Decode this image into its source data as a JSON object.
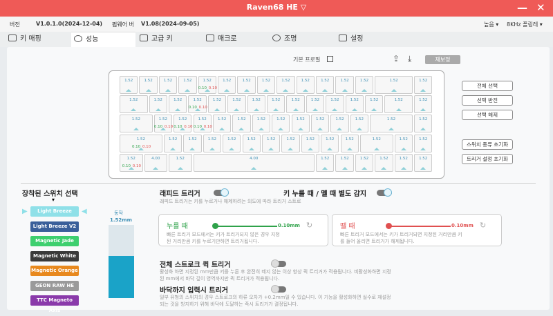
{
  "titlebar": {
    "title": "Raven68 HE ▽",
    "minimize": "—",
    "close": "✕"
  },
  "version": {
    "ver_label": "버전",
    "ver_value": "V1.0.1.0(2024-12-04)",
    "fw_label": "펌웨어 버",
    "fw_value": "V1.08(2024-09-05)",
    "right1": "높음 ▾",
    "right2": "8KHz 폴링레 ▾"
  },
  "tabs": [
    "키 매핑",
    "성능",
    "고급 키",
    "매크로",
    "조명",
    "설정"
  ],
  "profile": {
    "label": "기본 프로필",
    "button": "재보정"
  },
  "keyboard": {
    "rows": [
      [
        [
          "1.52"
        ],
        [
          "1.52"
        ],
        [
          "1.52"
        ],
        [
          "1.52"
        ],
        [
          "1.52",
          "0.10",
          "0.10"
        ],
        [
          "1.52"
        ],
        [
          "1.52"
        ],
        [
          "1.52"
        ],
        [
          "1.52"
        ],
        [
          "1.52"
        ],
        [
          "1.52"
        ],
        [
          "1.52"
        ],
        [
          "1.52"
        ],
        [
          "1.52"
        ],
        [
          "1.52"
        ]
      ],
      [
        [
          "1.52"
        ],
        [
          "1.52"
        ],
        [
          "1.52"
        ],
        [
          "1.52",
          "0.10",
          "0.10"
        ],
        [
          "1.52"
        ],
        [
          "1.52"
        ],
        [
          "1.52"
        ],
        [
          "1.52"
        ],
        [
          "1.52"
        ],
        [
          "1.52"
        ],
        [
          "1.52"
        ],
        [
          "1.52"
        ],
        [
          "1.52"
        ],
        [
          "1.52"
        ],
        [
          "1.52"
        ]
      ],
      [
        [
          "1.52"
        ],
        [
          "1.52",
          "0.10",
          "0.10"
        ],
        [
          "1.52",
          "0.10",
          "0.10"
        ],
        [
          "1.52",
          "0.10",
          "0.10"
        ],
        [
          "1.52"
        ],
        [
          "1.52"
        ],
        [
          "1.52"
        ],
        [
          "1.52"
        ],
        [
          "1.52"
        ],
        [
          "1.52"
        ],
        [
          "1.52"
        ],
        [
          "1.52"
        ],
        [
          "1.52"
        ],
        [
          "1.52"
        ]
      ],
      [
        [
          "1.52",
          "0.10",
          "0.10"
        ],
        [
          "1.52"
        ],
        [
          "1.52"
        ],
        [
          "1.52"
        ],
        [
          "1.52"
        ],
        [
          "1.52"
        ],
        [
          "1.52"
        ],
        [
          "1.52"
        ],
        [
          "1.52"
        ],
        [
          "1.52"
        ],
        [
          "1.52"
        ],
        [
          "1.52"
        ],
        [
          "1.52"
        ],
        [
          "1.52"
        ]
      ],
      [
        [
          "1.52",
          "0.10",
          "0.10"
        ],
        [
          "4.00"
        ],
        [
          "1.52"
        ],
        [
          "4.00"
        ],
        [
          "1.52"
        ],
        [
          "1.52"
        ],
        [
          "1.52"
        ],
        [
          "1.52"
        ],
        [
          "1.52"
        ],
        [
          "1.52"
        ]
      ]
    ]
  },
  "right_buttons": [
    "전체 선택",
    "선택 반전",
    "선택 해제",
    "스위치 종류 초기화",
    "트리거 설정 초기화"
  ],
  "switch_section": {
    "title": "장착된 스위치 선택",
    "arrow": "▾",
    "switches": [
      {
        "name": "Light Breeze",
        "color": "#8fe0e8"
      },
      {
        "name": "Light Breeze V2",
        "color": "#3a5f9a"
      },
      {
        "name": "Magnetic Jade",
        "color": "#3dcf6e"
      },
      {
        "name": "Magnetic White",
        "color": "#3a3a3a"
      },
      {
        "name": "Magnetic Orange",
        "color": "#e8891e"
      },
      {
        "name": "GEON RAW HE",
        "color": "#9a9a9a"
      },
      {
        "name": "TTC Magneto Axis",
        "color": "#8a3aaa"
      }
    ],
    "gauge_label": "동작",
    "gauge_value": "1.52mm",
    "gauge_fill": 0.58
  },
  "rapid": {
    "title": "래피드 트리거",
    "desc": "래피드 트리거는 키를 누르거나 해제하려는 의도에 따라 트리거 스트로",
    "separate_title": "키 누를 때 / 뗄 때 별도 감지",
    "press": {
      "title": "누를 때",
      "value": "0.10mm",
      "desc1": "빠른 트리거 모드에서는 키가 트리거되지 않은 경우 지정",
      "desc2": "된 거리만큼 키를 누르기만하면 트리거됩니다."
    },
    "release": {
      "title": "뗄 때",
      "value": "0.10mm",
      "desc1": "빠른 트리거 모드에서는 키가 트리거되면 지정된 거리만큼 키",
      "desc2": "를 들어 올리면 트리거가 해제됩니다."
    }
  },
  "full_stroke": {
    "title": "전체 스트로크 퀵 트리거",
    "desc1": "활성화 하면 지정된 mm만큼 키를 누른 후 완전히 떼지 않는 이상 항상 퀵 트리거가 적용됩니다. 비활성화하면 지정",
    "desc2": "된 mm에서 바닥 깊이 영역까지만 퀵 트리거가 적용됩니다."
  },
  "bottom": {
    "title": "바닥까지 입력시 트리거",
    "desc1": "일부 유형의 스위치의 경우 스트로크의 하류 오차가 +0.2mm일 수 있습니다. 이 기능을 활성화하면 실수로 재설정",
    "desc2": "되는 것을 방지하기 위해 바닥에 도달하는 즉시 트리거가 결정됩니다."
  }
}
